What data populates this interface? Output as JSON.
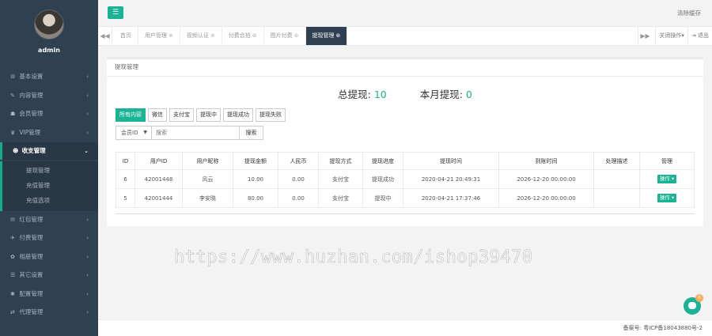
{
  "sidebar": {
    "admin": "admin",
    "items": [
      {
        "icon": "gear-icon",
        "glyph": "⚙",
        "label": "基本设置"
      },
      {
        "icon": "edit-icon",
        "glyph": "✎",
        "label": "内容管理"
      },
      {
        "icon": "users-icon",
        "glyph": "☗",
        "label": "会员管理"
      },
      {
        "icon": "vip-icon",
        "glyph": "♛",
        "label": "VIP管理"
      },
      {
        "icon": "user-icon",
        "glyph": "☻",
        "label": "收支管理"
      },
      {
        "icon": "gift-icon",
        "glyph": "✉",
        "label": "红包管理"
      },
      {
        "icon": "cart-icon",
        "glyph": "✈",
        "label": "付费管理"
      },
      {
        "icon": "album-icon",
        "glyph": "✿",
        "label": "相册管理"
      },
      {
        "icon": "other-icon",
        "glyph": "☰",
        "label": "其它设置"
      },
      {
        "icon": "config-icon",
        "glyph": "✱",
        "label": "配置管理"
      },
      {
        "icon": "agent-icon",
        "glyph": "⇄",
        "label": "代理管理"
      }
    ],
    "subitems": [
      "提现管理",
      "充值管理",
      "充值选项"
    ]
  },
  "topbar": {
    "menu_glyph": "☰",
    "clear_cache": "清除缓存"
  },
  "tabs": [
    {
      "label": "首页",
      "closable": false
    },
    {
      "label": "用户管理",
      "closable": true
    },
    {
      "label": "视频认证",
      "closable": true
    },
    {
      "label": "付费合拍",
      "closable": true
    },
    {
      "label": "图片付费",
      "closable": true
    },
    {
      "label": "提现管理",
      "closable": true,
      "active": true
    }
  ],
  "tab_actions": {
    "close_ops": "关闭操作",
    "logout": "退出"
  },
  "panel": {
    "title": "提现管理",
    "total_label": "总提现:",
    "total_value": "10",
    "month_label": "本月提现:",
    "month_value": "0"
  },
  "filters": [
    "所有内容",
    "微信",
    "支付宝",
    "提现中",
    "提现成功",
    "提现失败"
  ],
  "search": {
    "select_value": "会员ID",
    "placeholder": "搜索",
    "button": "搜索"
  },
  "table": {
    "headers": [
      "ID",
      "用户ID",
      "用户昵称",
      "提现金额",
      "人民币",
      "提现方式",
      "提现进度",
      "提现时间",
      "到账时间",
      "处理描述",
      "管理"
    ],
    "rows": [
      [
        "6",
        "42001448",
        "风云",
        "10.00",
        "0.00",
        "支付宝",
        "提现成功",
        "2020-04-21 20:49:31",
        "2026-12-20 00:00:00",
        "",
        "操作"
      ],
      [
        "5",
        "42001444",
        "李安晓",
        "80.00",
        "0.00",
        "支付宝",
        "提现中",
        "2020-04-21 17:37:46",
        "2026-12-20 00:00:00",
        "",
        "操作"
      ]
    ]
  },
  "watermark": "https://www.huzhan.com/ishop39470",
  "chat_badge": "6",
  "footer": "备案号: 粤ICP备18043880号-2"
}
